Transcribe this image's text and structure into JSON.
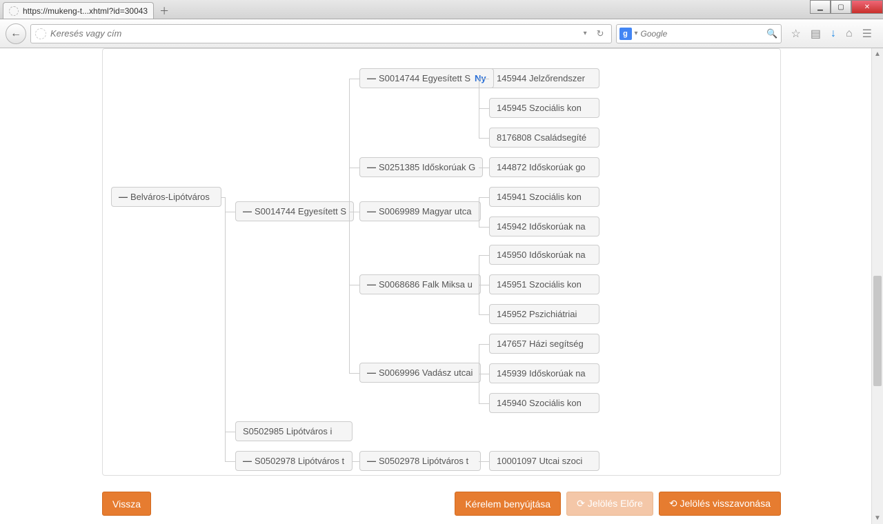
{
  "window": {
    "tab_title": "https://mukeng-t...xhtml?id=30043"
  },
  "nav": {
    "url_placeholder": "Keresés vagy cím",
    "search_placeholder": "Google",
    "search_provider_initial": "g"
  },
  "tree": {
    "root": {
      "label": "Belváros-Lipótváros",
      "expandable": true
    },
    "l2": [
      {
        "id": "l2a",
        "label": "S0014744 Egyesített S",
        "expandable": true
      },
      {
        "id": "l2b",
        "label": "S0502985 Lipótváros i",
        "expandable": false
      },
      {
        "id": "l2c",
        "label": "S0502978 Lipótváros t",
        "expandable": true
      }
    ],
    "l3": [
      {
        "id": "l3a",
        "parent": "l2a",
        "label": "S0014744 Egyesített S",
        "suffix": "Ny",
        "expandable": true
      },
      {
        "id": "l3b",
        "parent": "l2a",
        "label": "S0251385 Időskorúak G",
        "expandable": true
      },
      {
        "id": "l3c",
        "parent": "l2a",
        "label": "S0069989 Magyar utca",
        "expandable": true
      },
      {
        "id": "l3d",
        "parent": "l2a",
        "label": "S0068686 Falk Miksa u",
        "expandable": true
      },
      {
        "id": "l3e",
        "parent": "l2a",
        "label": "S0069996 Vadász utcai",
        "expandable": true
      },
      {
        "id": "l3f",
        "parent": "l2c",
        "label": "S0502978 Lipótváros t",
        "expandable": true
      }
    ],
    "l4": [
      {
        "parent": "l3a",
        "label": "145944 Jelzőrendszer"
      },
      {
        "parent": "l3a",
        "label": "145945 Szociális kon"
      },
      {
        "parent": "l3a",
        "label": "8176808 Családsegíté"
      },
      {
        "parent": "l3b",
        "label": "144872 Időskorúak go"
      },
      {
        "parent": "l3c",
        "label": "145941 Szociális kon"
      },
      {
        "parent": "l3c",
        "label": "145942 Időskorúak na"
      },
      {
        "parent": "l3d",
        "label": "145950 Időskorúak na"
      },
      {
        "parent": "l3d",
        "label": "145951 Szociális kon"
      },
      {
        "parent": "l3d",
        "label": "145952 Pszichiátriai"
      },
      {
        "parent": "l3e",
        "label": "147657 Házi segítség"
      },
      {
        "parent": "l3e",
        "label": "145939 Időskorúak na"
      },
      {
        "parent": "l3e",
        "label": "145940 Szociális kon"
      },
      {
        "parent": "l3f",
        "label": "10001097 Utcai szoci"
      }
    ]
  },
  "footer": {
    "back": "Vissza",
    "submit": "Kérelem benyújtása",
    "forward": "Jelölés Előre",
    "revoke": "Jelölés visszavonása"
  }
}
